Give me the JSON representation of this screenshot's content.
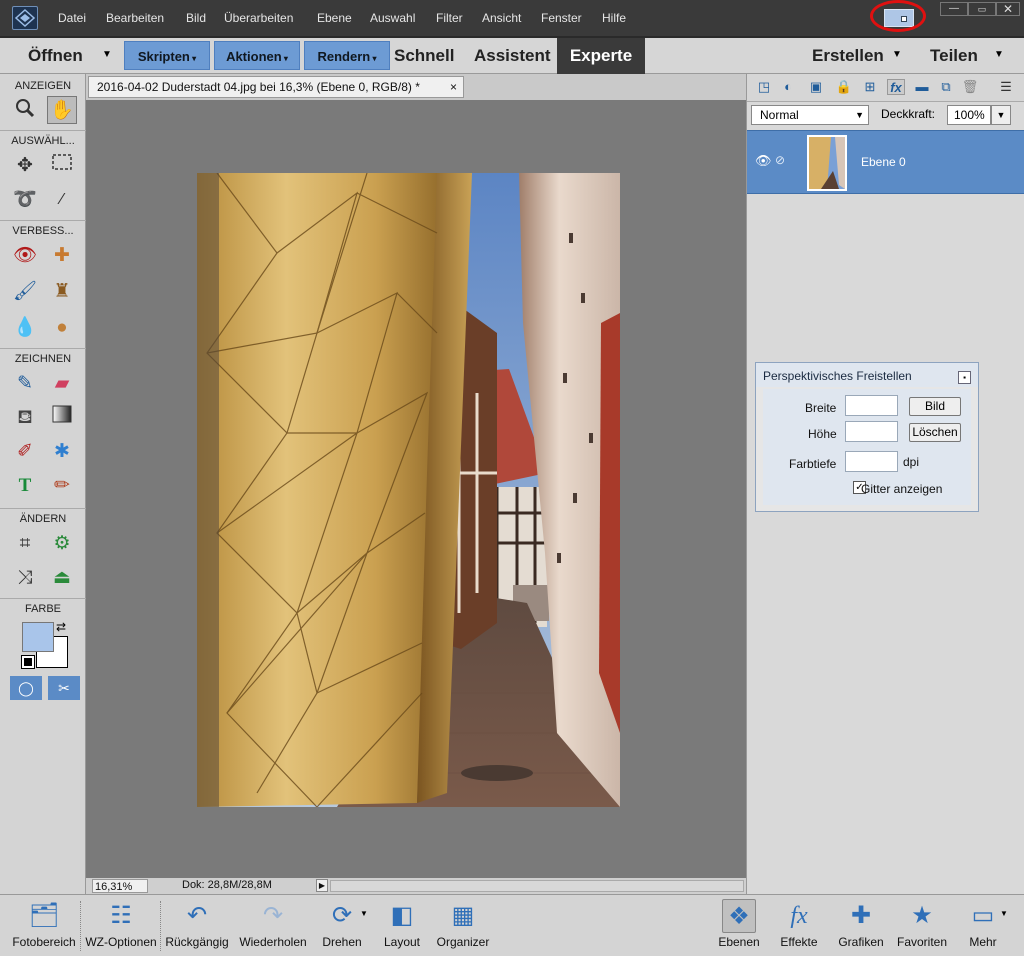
{
  "menubar": {
    "items": [
      "Datei",
      "Bearbeiten",
      "Bild",
      "Überarbeiten",
      "Ebene",
      "Auswahl",
      "Filter",
      "Ansicht",
      "Fenster",
      "Hilfe"
    ]
  },
  "modebar": {
    "open": "Öffnen",
    "scripts": "Skripten",
    "actions": "Aktionen",
    "render": "Rendern",
    "quick": "Schnell",
    "guided": "Assistent",
    "expert": "Experte",
    "create": "Erstellen",
    "share": "Teilen"
  },
  "toolbox": {
    "sections": [
      "ANZEIGEN",
      "AUSWÄHL...",
      "VERBESS...",
      "ZEICHNEN",
      "ÄNDERN",
      "FARBE"
    ],
    "fg_color": "#a9c5ea",
    "bg_color": "#ffffff"
  },
  "document": {
    "tab_title": "2016-04-02 Duderstadt 04.jpg bei 16,3% (Ebene 0, RGB/8) *",
    "close": "×",
    "zoom": "16,31%",
    "doc_size": "Dok: 28,8M/28,8M"
  },
  "layers": {
    "blend_mode": "Normal",
    "opacity_label": "Deckkraft:",
    "opacity": "100%",
    "layer_name": "Ebene 0"
  },
  "dialog": {
    "title": "Perspektivisches Freistellen",
    "width_label": "Breite",
    "height_label": "Höhe",
    "resolution_label": "Farbtiefe",
    "unit": "dpi",
    "image_button": "Bild",
    "clear_button": "Löschen",
    "grid_label": "Gitter anzeigen",
    "grid_checked": true
  },
  "bottombar": {
    "items": [
      "Fotobereich",
      "WZ-Optionen",
      "Rückgängig",
      "Wiederholen",
      "Drehen",
      "Layout",
      "Organizer",
      "Ebenen",
      "Effekte",
      "Grafiken",
      "Favoriten",
      "Mehr"
    ]
  }
}
